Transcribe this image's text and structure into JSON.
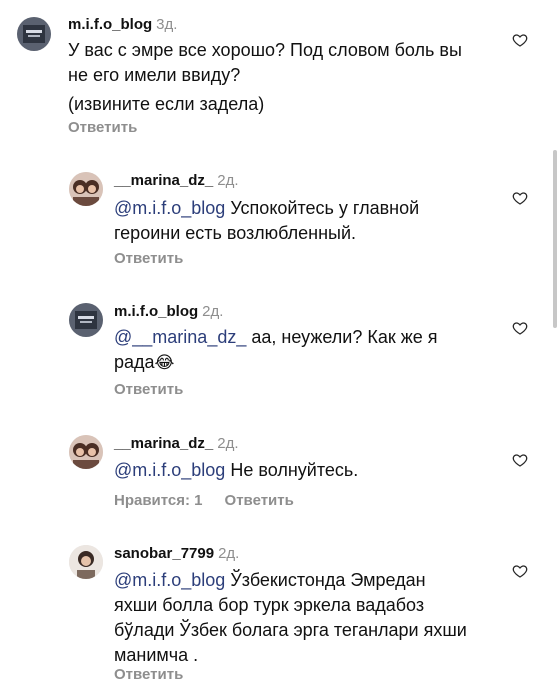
{
  "comments": [
    {
      "username": "m.i.f.o_blog",
      "time": "3д.",
      "mention": "",
      "lines": [
        "У вас с эмре все хорошо? Под словом боль вы",
        "не его имели ввиду?",
        "(извините если задела)"
      ],
      "reply_label": "Ответить",
      "likes_label": ""
    },
    {
      "username": "__marina_dz_",
      "time": "2д.",
      "mention": "@m.i.f.o_blog",
      "lines": [
        " Успокойтесь  у главной",
        "героини  есть возлюбленный."
      ],
      "reply_label": "Ответить",
      "likes_label": ""
    },
    {
      "username": "m.i.f.o_blog",
      "time": "2д.",
      "mention": "@__marina_dz_",
      "lines": [
        " аа, неужели? Как же я",
        "рада"
      ],
      "emoji": "😂",
      "reply_label": "Ответить",
      "likes_label": ""
    },
    {
      "username": "__marina_dz_",
      "time": "2д.",
      "mention": "@m.i.f.o_blog",
      "lines": [
        " Не волнуйтесь."
      ],
      "reply_label": "Ответить",
      "likes_label": "Нравится: 1"
    },
    {
      "username": "sanobar_7799",
      "time": "2д.",
      "mention": "@m.i.f.o_blog",
      "lines": [
        " Ўзбекистонда  Эмредан",
        "яхши болла бор турк эркела вадабоз",
        "бўлади Ўзбек болага эрга теганлари яхши",
        "манимча ."
      ],
      "reply_label": "Ответить",
      "likes_label": ""
    }
  ],
  "icons": {
    "like": "heart-outline-icon"
  },
  "colors": {
    "mention": "#2c3e7a",
    "secondary": "#8e8e8e"
  }
}
